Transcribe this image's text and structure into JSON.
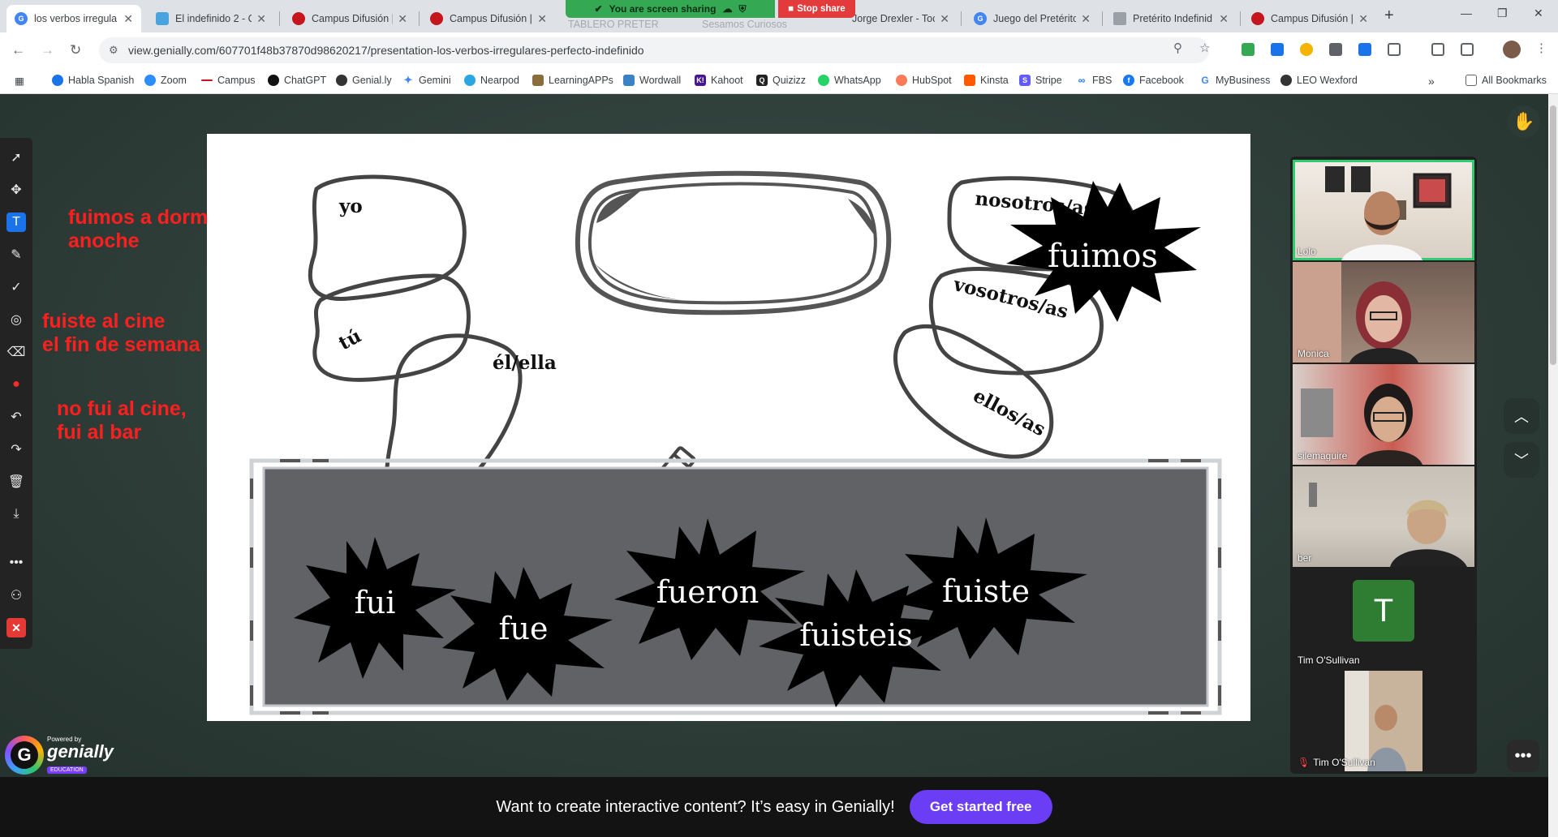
{
  "browser": {
    "tabs": [
      {
        "title": "los verbos irregula",
        "active": true,
        "icon_color": "#4285f4"
      },
      {
        "title": "El indefinido 2 - Q",
        "active": false,
        "icon_color": "#4aa3df"
      },
      {
        "title": "Campus Difusión |",
        "active": false,
        "icon_color": "#c4161c"
      },
      {
        "title": "Campus Difusión |",
        "active": false,
        "icon_color": "#c4161c"
      },
      {
        "title": "TABLERO PRETER",
        "active": false,
        "icon_color": "#34a853"
      },
      {
        "title": "Sesamos Curiosos",
        "active": false,
        "icon_color": "#4285f4"
      },
      {
        "title": "Jorge Drexler - Toc",
        "active": false,
        "icon_color": "#ea4335"
      },
      {
        "title": "Juego del Pretérito",
        "active": false,
        "icon_color": "#4285f4"
      },
      {
        "title": "Pretérito Indefinid",
        "active": false,
        "icon_color": "#9aa0a6"
      },
      {
        "title": "Campus Difusión |",
        "active": false,
        "icon_color": "#c4161c"
      }
    ],
    "share_notice": "You are screen sharing",
    "stop_share": "Stop share",
    "url": "view.genially.com/607701f48b37870d98620217/presentation-los-verbos-irregulares-perfecto-indefinido",
    "bookmarks": [
      {
        "label": "Habla Spanish",
        "icon_color": "#1a73e8"
      },
      {
        "label": "Zoom",
        "icon_color": "#2d8cff"
      },
      {
        "label": "Campus",
        "icon_color": "#c4161c"
      },
      {
        "label": "ChatGPT",
        "icon_color": "#111111"
      },
      {
        "label": "Genial.ly",
        "icon_color": "#333333"
      },
      {
        "label": "Gemini",
        "icon_color": "#4285f4"
      },
      {
        "label": "Nearpod",
        "icon_color": "#2aa7e0"
      },
      {
        "label": "LearningAPPs",
        "icon_color": "#8a6d3b"
      },
      {
        "label": "Wordwall",
        "icon_color": "#3b82c4"
      },
      {
        "label": "Kahoot",
        "icon_color": "#46178f"
      },
      {
        "label": "Quizizz",
        "icon_color": "#222222"
      },
      {
        "label": "WhatsApp",
        "icon_color": "#25d366"
      },
      {
        "label": "HubSpot",
        "icon_color": "#ff7a59"
      },
      {
        "label": "Kinsta",
        "icon_color": "#ff5a00"
      },
      {
        "label": "Stripe",
        "icon_color": "#635bff"
      },
      {
        "label": "FBS",
        "icon_color": "#1877f2"
      },
      {
        "label": "Facebook",
        "icon_color": "#1877f2"
      },
      {
        "label": "MyBusiness",
        "icon_color": "#4285f4"
      },
      {
        "label": "LEO Wexford",
        "icon_color": "#333333"
      }
    ],
    "all_bookmarks": "All Bookmarks"
  },
  "annotations": {
    "note1": "fuimos a dormir\nanoche",
    "note2": "fuiste al cine\nel fin de semana pasado?",
    "note3": "no fui al cine,\nfui al bar"
  },
  "slide": {
    "pronouns": {
      "yo": "yo",
      "tu": "tú",
      "el": "él/ella",
      "nosotros": "nosotros/as",
      "vosotros": "vosotros/as",
      "ellos": "ellos/as"
    },
    "placed_word": "fuimos",
    "word_bank": [
      "fui",
      "fue",
      "fueron",
      "fuisteis",
      "fuiste"
    ]
  },
  "genially": {
    "powered_by": "Powered by",
    "name": "genially",
    "edition": "EDUCATION"
  },
  "participants": [
    {
      "name": "Lolo",
      "speaking": true,
      "type": "video"
    },
    {
      "name": "Monica",
      "speaking": false,
      "type": "video"
    },
    {
      "name": "silemaguire",
      "speaking": false,
      "type": "video"
    },
    {
      "name": "ber",
      "speaking": false,
      "type": "video"
    },
    {
      "name": "Tim O'Sullivan",
      "speaking": false,
      "type": "avatar",
      "initial": "T"
    },
    {
      "name": "Tim O'Sullivan",
      "speaking": false,
      "type": "video",
      "muted": true
    }
  ],
  "banner": {
    "text": "Want to create interactive content? It’s easy in Genially!",
    "button": "Get started free"
  }
}
